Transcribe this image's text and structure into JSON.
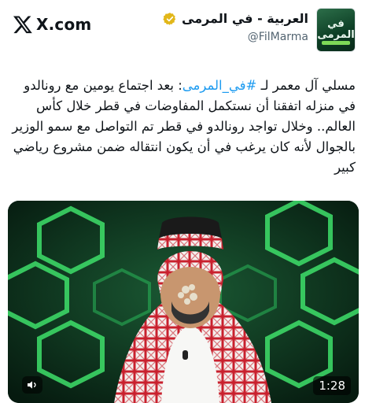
{
  "header": {
    "brand_label": "X.com",
    "author": {
      "name": "العربية - في المرمى",
      "handle": "@FilMarma",
      "avatar_text": "في المرمى"
    }
  },
  "tweet": {
    "before_hashtag": "مسلي آل معمر لـ ",
    "hashtag": "#في_المرمى",
    "after_hashtag": ": بعد اجتماع يومين مع رونالدو في منزله اتفقنا أن نستكمل المفاوضات في قطر خلال كأس العالم.. وخلال تواجد رونالدو في قطر تم التواصل مع سمو الوزير بالجوال لأنه كان يرغب في أن يكون انتقاله ضمن مشروع رياضي كبير"
  },
  "video": {
    "duration": "1:28",
    "mute_icon": "speaker-icon"
  },
  "colors": {
    "link": "#1d9bf0",
    "verified": "#e2b719",
    "text": "#0f1419",
    "muted": "#536471"
  }
}
